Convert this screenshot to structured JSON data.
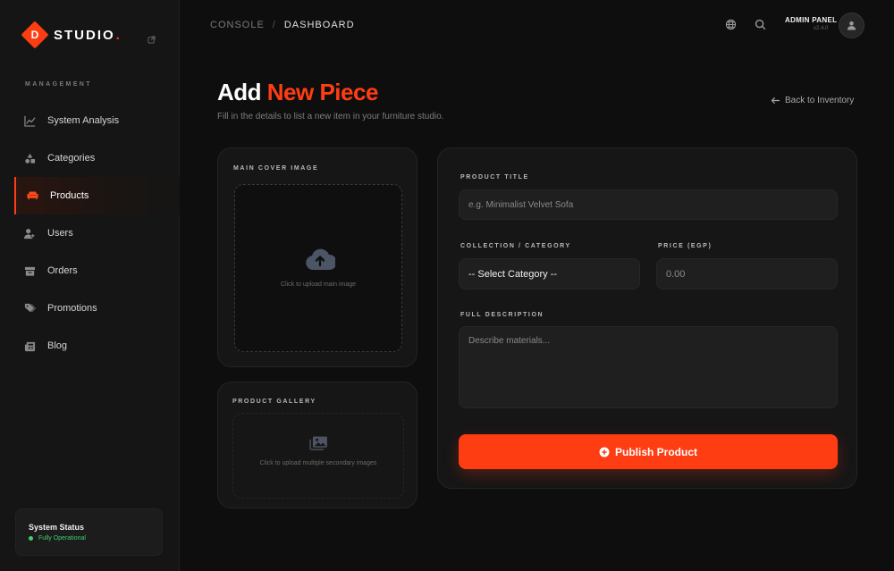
{
  "brand": {
    "letter": "D",
    "name": "STUDIO",
    "dot": ".",
    "accent_color": "#ff3d12"
  },
  "sidebar": {
    "section_label": "MANAGEMENT",
    "items": [
      {
        "label": "System Analysis",
        "icon": "chart-line-icon",
        "active": false
      },
      {
        "label": "Categories",
        "icon": "shapes-icon",
        "active": false
      },
      {
        "label": "Products",
        "icon": "couch-icon",
        "active": true
      },
      {
        "label": "Users",
        "icon": "users-icon",
        "active": false
      },
      {
        "label": "Orders",
        "icon": "box-icon",
        "active": false
      },
      {
        "label": "Promotions",
        "icon": "tags-icon",
        "active": false
      },
      {
        "label": "Blog",
        "icon": "newspaper-icon",
        "active": false
      }
    ],
    "status": {
      "title": "System Status",
      "text": "Fully Operational",
      "color": "#3fcf6f"
    }
  },
  "header": {
    "breadcrumb": [
      "CONSOLE",
      "DASHBOARD"
    ],
    "separator": "/",
    "admin": {
      "name": "ADMIN PANEL",
      "version": "v2.4.0"
    }
  },
  "page": {
    "title_part1": "Add",
    "title_part2": "New Piece",
    "subtitle": "Fill in the details to list a new item in your furniture studio.",
    "back_link": "Back to Inventory"
  },
  "cover": {
    "label": "MAIN COVER IMAGE",
    "hint": "Click to upload main image"
  },
  "gallery": {
    "label": "PRODUCT GALLERY",
    "hint": "Click to upload multiple secondary images"
  },
  "form": {
    "title_label": "PRODUCT TITLE",
    "title_placeholder": "e.g. Minimalist Velvet Sofa",
    "title_value": "",
    "category_label": "COLLECTION / CATEGORY",
    "category_selected": "-- Select Category --",
    "price_label": "PRICE (EGP)",
    "price_placeholder": "0.00",
    "description_label": "FULL DESCRIPTION",
    "description_placeholder": "Describe materials...",
    "publish_label": "Publish Product"
  }
}
